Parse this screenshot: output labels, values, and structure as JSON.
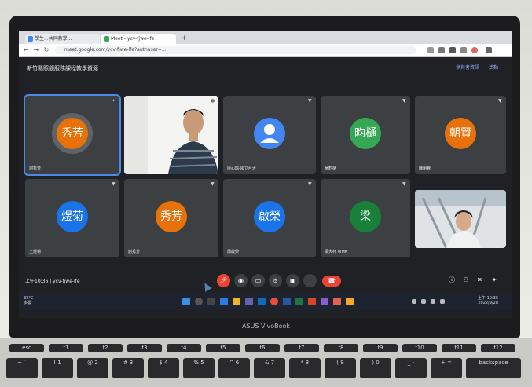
{
  "browser": {
    "tabs": [
      {
        "label": "學生...共同教學...",
        "color": "#4285f4"
      },
      {
        "label": "Meet - ycv-fjwe-lfe",
        "color": "#34a853"
      }
    ],
    "url": "meet.google.com/ycv-fjwe-lfe?authuser=..."
  },
  "meeting": {
    "title": "新竹縣照顧服務課程教學資源",
    "header_actions": [
      "參與者資訊",
      "活動"
    ],
    "time_code": "上午10:36 | ycv-fjwe-lfe",
    "participants": [
      {
        "avatar_text": "秀芳",
        "name": "謝秀芳",
        "color": "#e8710a",
        "type": "avatar"
      },
      {
        "avatar_text": "",
        "name": "",
        "color": "",
        "type": "video-person"
      },
      {
        "avatar_text": "",
        "name": "廖心瑜-國立台大",
        "color": "#4285f4",
        "type": "generic"
      },
      {
        "avatar_text": "畇樋",
        "name": "吳畇樋",
        "color": "#34a853",
        "type": "avatar"
      },
      {
        "avatar_text": "朝賢",
        "name": "陳朝賢",
        "color": "#e8710a",
        "type": "avatar"
      },
      {
        "avatar_text": "煜菊",
        "name": "王煜菊",
        "color": "#1a73e8",
        "type": "avatar"
      },
      {
        "avatar_text": "秀芳",
        "name": "謝秀芳",
        "color": "#e8710a",
        "type": "avatar"
      },
      {
        "avatar_text": "啟榮",
        "name": "邱啟榮",
        "color": "#1a73e8",
        "type": "avatar"
      },
      {
        "avatar_text": "梁",
        "name": "梁大杯 WMK",
        "color": "#188038",
        "type": "avatar"
      },
      {
        "avatar_text": "",
        "name": "",
        "color": "",
        "type": "video-room"
      }
    ]
  },
  "taskbar": {
    "weather_temp": "33°C",
    "weather_desc": "多雲",
    "clock_time": "上午 10:36",
    "clock_date": "2022/9/28"
  },
  "device": {
    "brand": "ASUS VivoBook"
  },
  "keyboard": {
    "row1": [
      "esc",
      "f1",
      "f2",
      "f3",
      "f4",
      "f5",
      "f6",
      "f7",
      "f8",
      "f9",
      "f10",
      "f11",
      "f12"
    ],
    "row2": [
      "~",
      "!",
      "@",
      "#",
      "$",
      "%",
      "^",
      "&",
      "*",
      "(",
      ")",
      "_",
      "+",
      "backspace"
    ],
    "row2_sub": [
      "`",
      "1",
      "2",
      "3",
      "4",
      "5",
      "6",
      "7",
      "8",
      "9",
      "0",
      "-",
      "="
    ]
  },
  "colors": {
    "meet_bg": "#202124",
    "tile_bg": "#3c4043",
    "end_call": "#ea4335",
    "accent": "#8ab4f8"
  }
}
